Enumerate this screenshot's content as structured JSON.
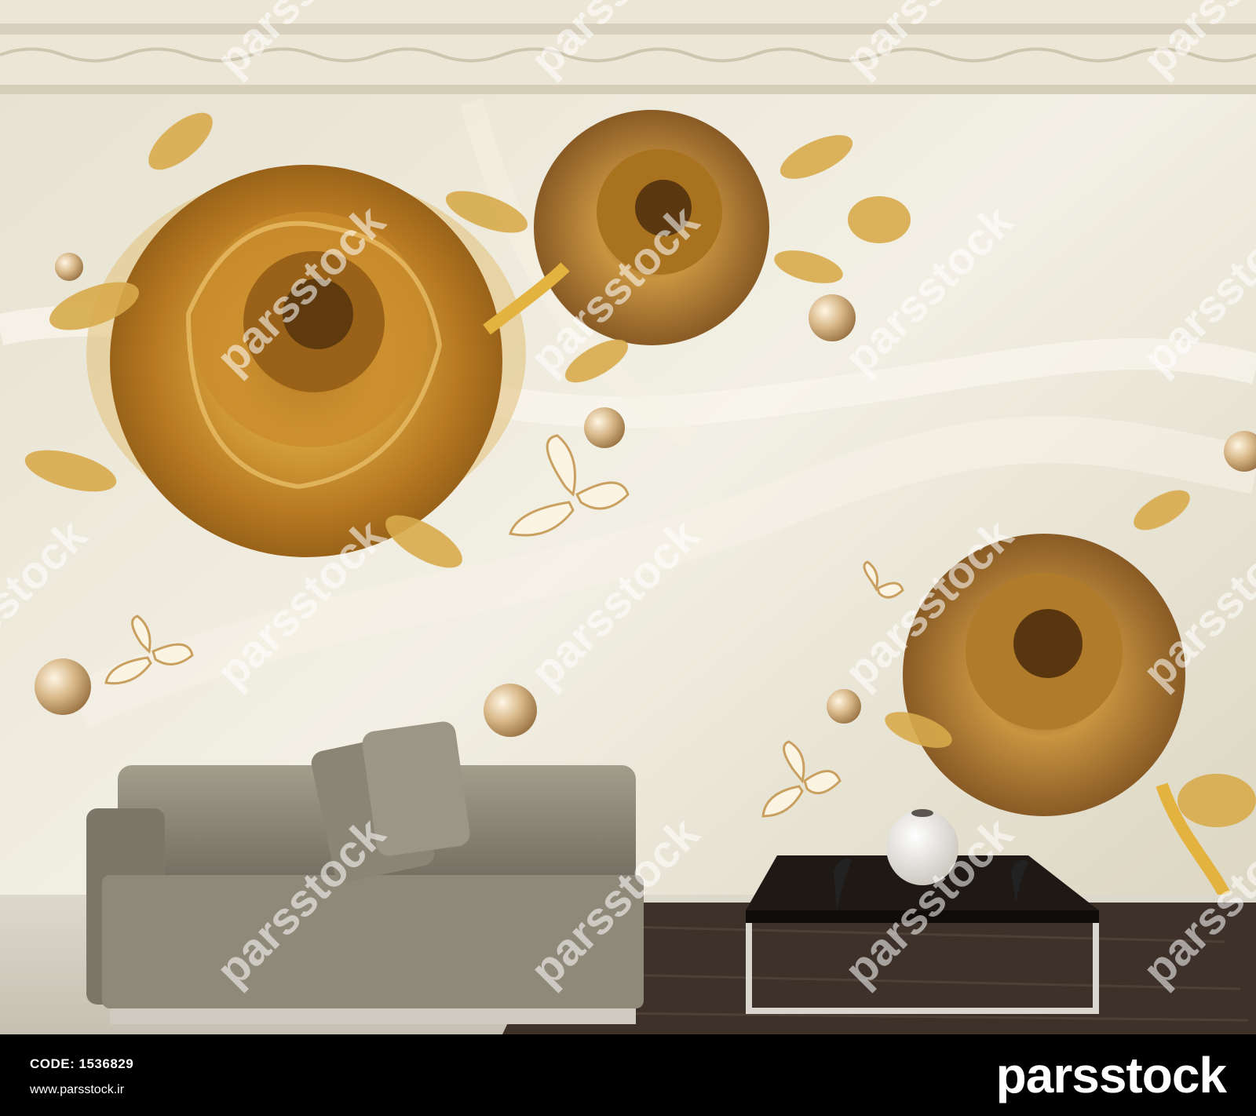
{
  "footer": {
    "code_label": "CODE:",
    "code_value": "1536829",
    "url": "www.parsstock.ir",
    "brand": "parsstock"
  },
  "watermark": {
    "text": "parsstock"
  },
  "colors": {
    "wall": "#e9e4d4",
    "gold": "#c8912e",
    "dark_gold": "#8a5a1a",
    "sofa": "#8c8676",
    "table": "#1c1714",
    "footer_bg": "#000000"
  }
}
